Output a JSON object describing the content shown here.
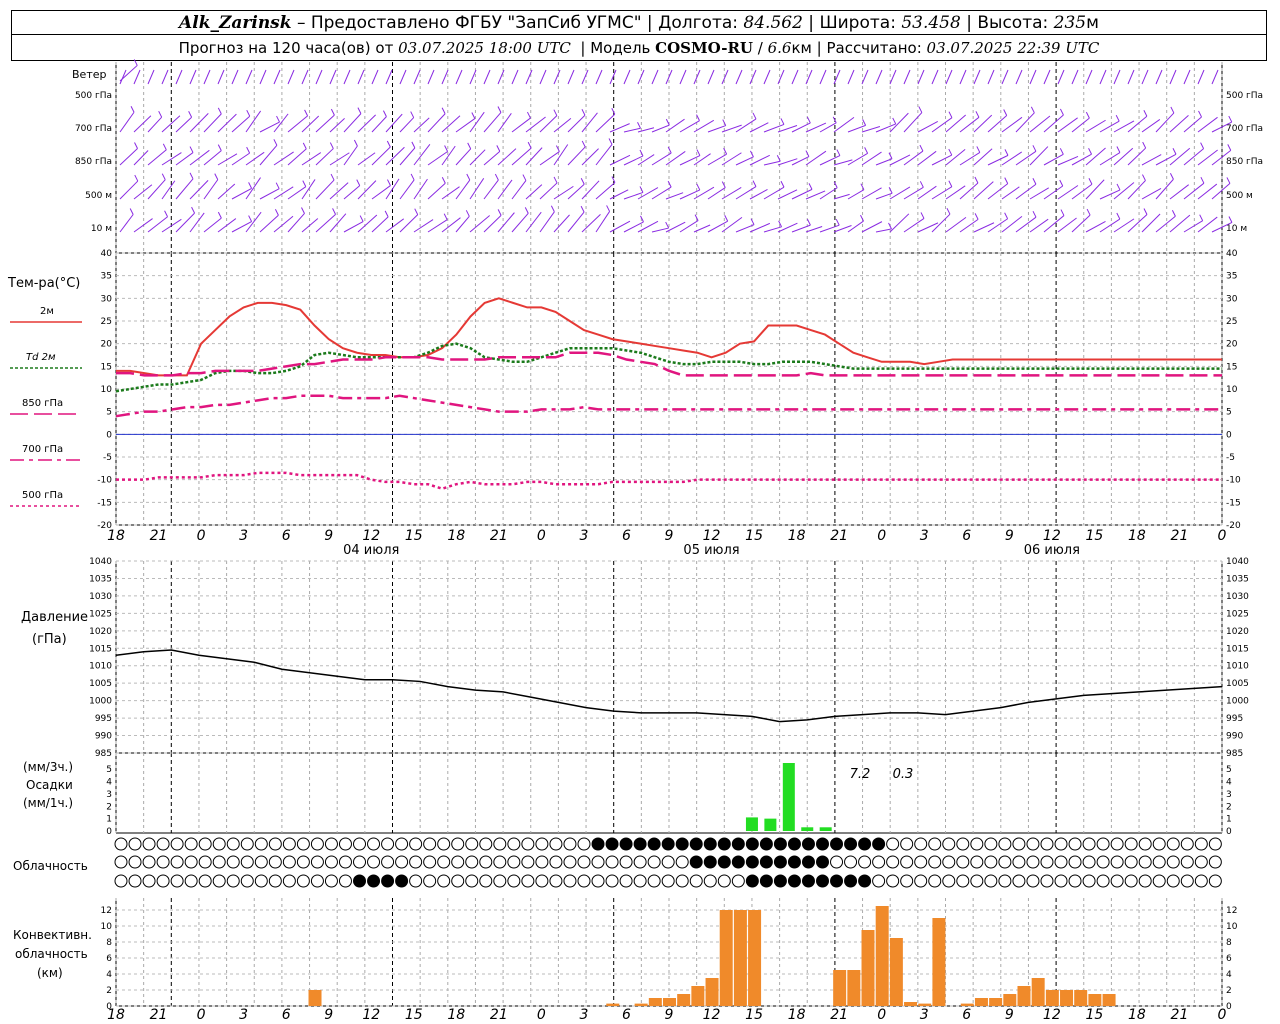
{
  "header": {
    "station": "Alk_Zarinsk",
    "provider": "– Предоставлено ФГБУ \"ЗапСиб УГМС\"",
    "lon_label": "Долгота:",
    "lon": "84.562",
    "lat_label": "Широта:",
    "lat": "53.458",
    "alt_label": "Высота:",
    "alt": "235",
    "alt_unit": "м",
    "forecast_label": "Прогноз на 120 часа(ов) от",
    "issued": "03.07.2025 18:00 UTC",
    "model_label": "Модель",
    "model": "COSMO-RU",
    "resolution": "6.6",
    "resolution_unit": "км",
    "computed_label": "Рассчитано:",
    "computed": "03.07.2025 22:39 UTC"
  },
  "panels": {
    "wind": {
      "title": "Ветер",
      "levels": [
        "500 гПа",
        "700 гПа",
        "850 гПа",
        "500 м",
        "10 м"
      ],
      "color": "#8a2be2"
    },
    "temperature": {
      "title": "Тем-ра(°C)",
      "legend": [
        {
          "label": "2м",
          "color": "#e53935",
          "style": "solid"
        },
        {
          "label": "Td 2м",
          "color": "#1b7a1b",
          "style": "dotted"
        },
        {
          "label": "850 гПа",
          "color": "#e0157f",
          "style": "dash"
        },
        {
          "label": "700 гПа",
          "color": "#e0157f",
          "style": "dashdot"
        },
        {
          "label": "500 гПа",
          "color": "#e0157f",
          "style": "dot"
        }
      ]
    },
    "pressure": {
      "title": "Давление",
      "unit": "(гПа)"
    },
    "precip": {
      "unit_top": "(мм/3ч.)",
      "title": "Осадки",
      "unit_bottom": "(мм/1ч.)",
      "annotations": [
        "7.2",
        "0.3"
      ]
    },
    "clouds": {
      "title": "Облачность"
    },
    "convective": {
      "title": "Конвективн.",
      "subtitle": "облачность",
      "unit": "(км)"
    }
  },
  "time_axis": {
    "hour_labels": [
      "18",
      "21",
      "0",
      "3",
      "6",
      "9",
      "12",
      "15",
      "18",
      "21",
      "0",
      "3",
      "6",
      "9",
      "12",
      "15",
      "18",
      "21",
      "0",
      "3",
      "6",
      "9",
      "12",
      "15",
      "18",
      "21",
      "0"
    ],
    "day_labels": [
      "04 июля",
      "05 июля",
      "06 июля"
    ]
  },
  "chart_data": [
    {
      "type": "line",
      "name": "temperature",
      "x_hours": [
        0,
        3,
        6,
        9,
        12,
        15,
        18,
        21,
        24,
        27,
        30,
        33,
        36,
        39,
        42,
        45,
        48,
        51,
        54,
        57,
        60,
        63,
        66,
        69,
        72,
        75,
        78,
        81,
        84,
        87,
        90,
        93,
        96,
        99,
        102,
        105,
        108,
        111,
        114,
        117,
        120,
        123,
        126,
        129,
        132,
        135,
        138,
        141,
        144,
        147,
        150,
        153,
        156,
        159,
        162,
        165,
        168,
        171,
        174,
        177,
        180,
        183,
        186,
        189,
        192,
        195,
        198,
        201,
        204,
        207,
        210,
        213,
        216,
        219,
        222,
        225,
        228,
        231,
        234
      ],
      "ylim": [
        -20,
        40
      ],
      "series": [
        {
          "name": "2м",
          "values": [
            14,
            14,
            13.5,
            13,
            13,
            13,
            20,
            23,
            26,
            28,
            29,
            29,
            28.5,
            27.5,
            24,
            21,
            19,
            18,
            17.5,
            17.5,
            17,
            17,
            17.5,
            19,
            22,
            26,
            29,
            30,
            29,
            28,
            28,
            27,
            25,
            23,
            22,
            21,
            20.5,
            20,
            19.5,
            19,
            18.5,
            18,
            17,
            18,
            20,
            20.5,
            24,
            24,
            24,
            23,
            22,
            20,
            18,
            17,
            16,
            16,
            16,
            15.5,
            16,
            16.5,
            16.5,
            16.5,
            16.5,
            16.5,
            16.5,
            16.5,
            16.5,
            16.5,
            16.5,
            16.5,
            16.5,
            16.5,
            16.5,
            16.5,
            16.5,
            16.5,
            16.5,
            16.5,
            16.5
          ]
        },
        {
          "name": "Td 2м",
          "values": [
            9.5,
            10,
            10.5,
            11,
            11,
            11.5,
            12,
            13.5,
            14,
            14,
            13.5,
            13.5,
            14,
            15,
            17.5,
            18,
            17.5,
            17,
            17,
            17,
            17,
            17,
            18,
            19.5,
            20,
            19,
            17,
            16.5,
            16,
            16,
            17,
            18,
            19,
            19,
            19,
            19,
            18.5,
            18,
            17,
            16,
            15.5,
            15.5,
            16,
            16,
            16,
            15.5,
            15.5,
            16,
            16,
            16,
            15.5,
            15,
            14.5,
            14.5,
            14.5,
            14.5,
            14.5,
            14.5,
            14.5,
            14.5,
            14.5,
            14.5,
            14.5,
            14.5,
            14.5,
            14.5,
            14.5,
            14.5,
            14.5,
            14.5,
            14.5,
            14.5,
            14.5,
            14.5,
            14.5,
            14.5,
            14.5,
            14.5,
            14.5
          ]
        },
        {
          "name": "850 гПа",
          "values": [
            13.5,
            13.5,
            13,
            13,
            13,
            13.5,
            13.5,
            14,
            14,
            14,
            14,
            14.5,
            15,
            15.5,
            15.5,
            16,
            16.5,
            16.5,
            16.5,
            17,
            17,
            17,
            17,
            16.5,
            16.5,
            16.5,
            16.5,
            17,
            17,
            17,
            17,
            17,
            18,
            18,
            18,
            17.5,
            16.5,
            16,
            15.5,
            14,
            13,
            13,
            13,
            13,
            13,
            13,
            13,
            13,
            13,
            13.5,
            13,
            13,
            13,
            13,
            13,
            13,
            13,
            13,
            13,
            13,
            13,
            13,
            13,
            13,
            13,
            13,
            13,
            13,
            13,
            13,
            13,
            13,
            13,
            13,
            13,
            13,
            13,
            13,
            13
          ]
        },
        {
          "name": "700 гПа",
          "values": [
            4,
            4.5,
            5,
            5,
            5.5,
            6,
            6,
            6.5,
            6.5,
            7,
            7.5,
            8,
            8,
            8.5,
            8.5,
            8.5,
            8,
            8,
            8,
            8,
            8.5,
            8,
            7.5,
            7,
            6.5,
            6,
            5.5,
            5,
            5,
            5,
            5.5,
            5.5,
            5.5,
            6,
            5.5,
            5.5,
            5.5,
            5.5,
            5.5,
            5.5,
            5.5,
            5.5,
            5.5,
            5.5,
            5.5,
            5.5,
            5.5,
            5.5,
            5.5,
            5.5,
            5.5,
            5.5,
            5.5,
            5.5,
            5.5,
            5.5,
            5.5,
            5.5,
            5.5,
            5.5,
            5.5,
            5.5,
            5.5,
            5.5,
            5.5,
            5.5,
            5.5,
            5.5,
            5.5,
            5.5,
            5.5,
            5.5,
            5.5,
            5.5,
            5.5,
            5.5,
            5.5,
            5.5,
            5.5
          ]
        },
        {
          "name": "500 гПа",
          "values": [
            -10,
            -10,
            -10,
            -9.5,
            -9.5,
            -9.5,
            -9.5,
            -9,
            -9,
            -9,
            -8.5,
            -8.5,
            -8.5,
            -9,
            -9,
            -9,
            -9,
            -9,
            -10,
            -10.5,
            -10.5,
            -11,
            -11,
            -12,
            -11,
            -10.5,
            -11,
            -11,
            -11,
            -10.5,
            -10.5,
            -11,
            -11,
            -11,
            -11,
            -10.5,
            -10.5,
            -10.5,
            -10.5,
            -10.5,
            -10.5,
            -10,
            -10,
            -10,
            -10,
            -10,
            -10,
            -10,
            -10,
            -10,
            -10,
            -10,
            -10,
            -10,
            -10,
            -10,
            -10,
            -10,
            -10,
            -10,
            -10,
            -10,
            -10,
            -10,
            -10,
            -10,
            -10,
            -10,
            -10,
            -10,
            -10,
            -10,
            -10,
            -10,
            -10,
            -10,
            -10,
            -10,
            -10
          ]
        }
      ]
    },
    {
      "type": "line",
      "name": "pressure",
      "x_hours": [
        0,
        3,
        6,
        9,
        12,
        15,
        18,
        21,
        24,
        27,
        30,
        33,
        36,
        39,
        42,
        45,
        48,
        51,
        54,
        57,
        60,
        63,
        66,
        69,
        72,
        75,
        78,
        81,
        84,
        87,
        90,
        93,
        96,
        99,
        102,
        105,
        108,
        111,
        114,
        117,
        120
      ],
      "ylim": [
        985,
        1040
      ],
      "values": [
        1013,
        1014,
        1014.5,
        1013,
        1012,
        1011,
        1009,
        1008,
        1007,
        1006,
        1006,
        1005.5,
        1004,
        1003,
        1002.5,
        1001,
        999.5,
        998,
        997,
        996.5,
        996.5,
        996.5,
        996,
        995.5,
        994,
        994.5,
        995.5,
        996,
        996.5,
        996.5,
        996,
        997,
        998,
        999.5,
        1000.5,
        1001.5,
        1002,
        1002.5,
        1003,
        1003.5,
        1004
      ]
    },
    {
      "type": "bar",
      "name": "precipitation",
      "x_hours": [
        69,
        71,
        73,
        75,
        77
      ],
      "ylim": [
        0,
        5.5
      ],
      "values": [
        1.1,
        1.0,
        5.5,
        0.3,
        0.3
      ]
    },
    {
      "type": "bar",
      "name": "convective_cloud_km",
      "x_hours": [
        7,
        8,
        9,
        10,
        11,
        12,
        13,
        14,
        15,
        16,
        17,
        18,
        19,
        20,
        21,
        22,
        23,
        24,
        25,
        26,
        27,
        28,
        29,
        30,
        31,
        32
      ],
      "ylim": [
        0,
        13
      ],
      "values": [
        2,
        0.3,
        0.3,
        1,
        1,
        1.5,
        3.5,
        12,
        12,
        0,
        0,
        4.5,
        0,
        0,
        4.5,
        9.5,
        12.5,
        8.5,
        0.5,
        0.5,
        11,
        0.3,
        1,
        1,
        2.5,
        1.5
      ]
    }
  ]
}
